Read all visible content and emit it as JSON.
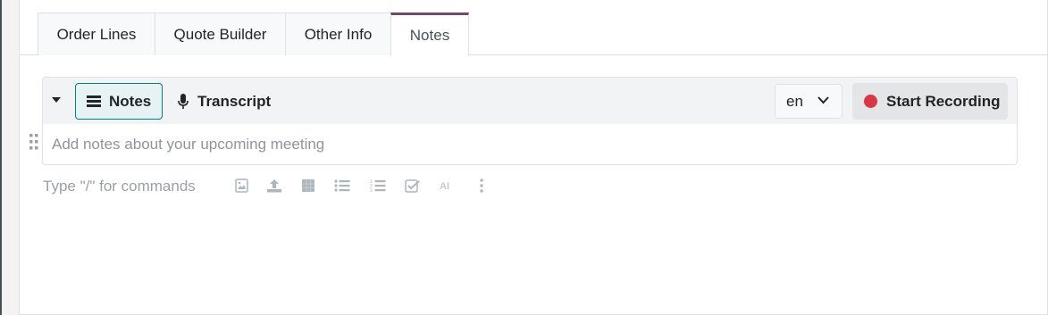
{
  "tabs": [
    {
      "label": "Order Lines"
    },
    {
      "label": "Quote Builder"
    },
    {
      "label": "Other Info"
    },
    {
      "label": "Notes"
    }
  ],
  "toolbar": {
    "notes_label": "Notes",
    "transcript_label": "Transcript",
    "language_value": "en",
    "record_label": "Start Recording"
  },
  "editor": {
    "placeholder": "Add notes about your upcoming meeting"
  },
  "commands": {
    "hint": "Type \"/\" for commands",
    "icons": [
      "image-icon",
      "upload-icon",
      "table-icon",
      "bulleted-list-icon",
      "numbered-list-icon",
      "checklist-icon",
      "ai-icon",
      "more-icon"
    ]
  },
  "colors": {
    "accent": "#714b67",
    "active_toggle_border": "#017e84",
    "record_dot": "#dc3545"
  }
}
